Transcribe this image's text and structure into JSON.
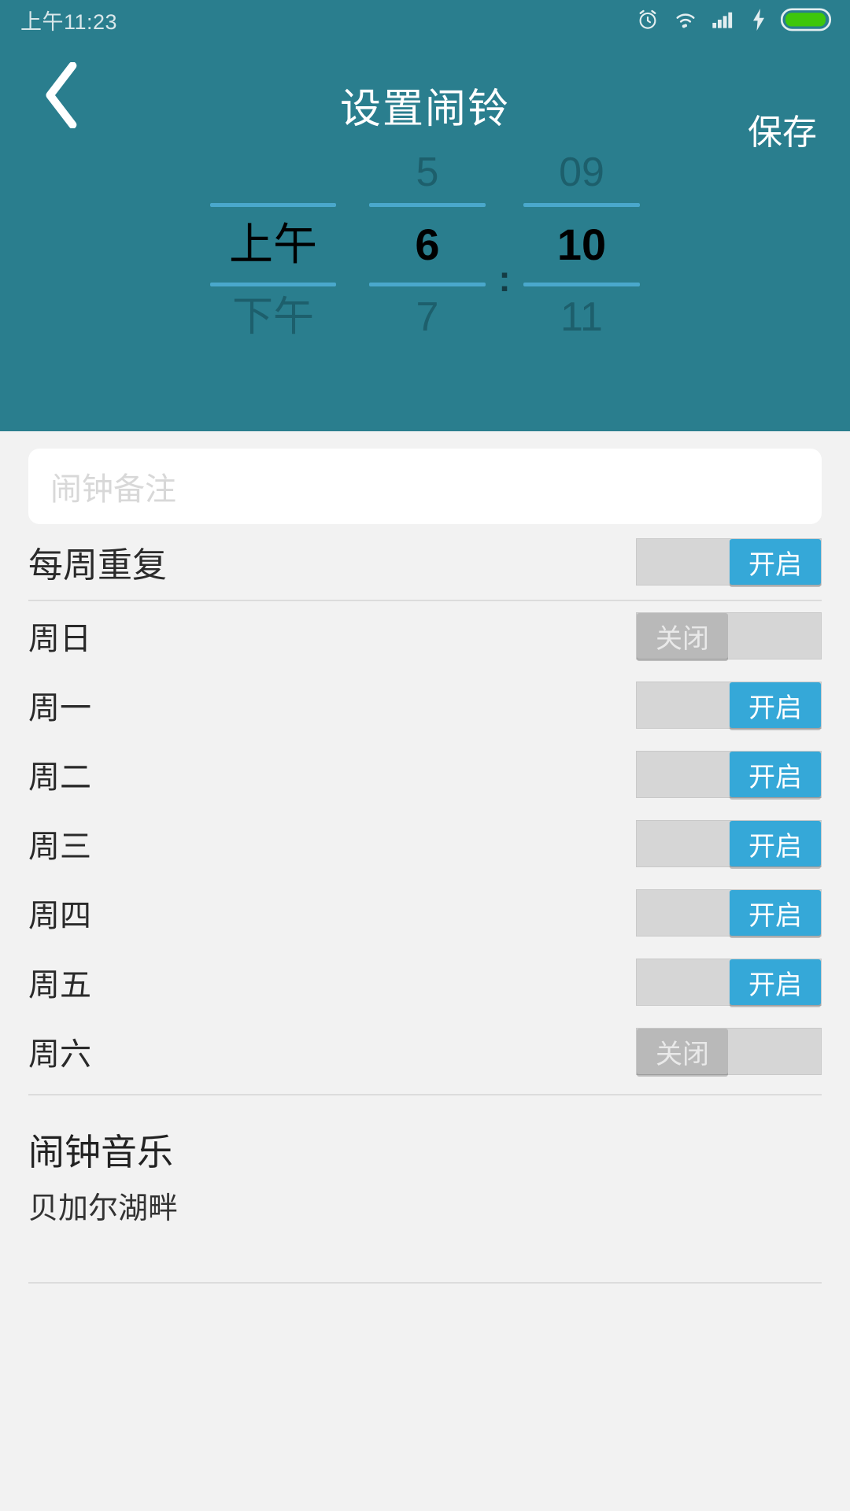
{
  "statusbar": {
    "time": "上午11:23",
    "icons": [
      "alarm-icon",
      "wifi-icon",
      "signal-icon",
      "charging-icon",
      "battery-icon"
    ]
  },
  "header": {
    "back_icon": "chevron-left-icon",
    "title": "设置闹铃",
    "save_label": "保存"
  },
  "time_picker": {
    "ampm": {
      "prev": "",
      "current": "上午",
      "next": "下午"
    },
    "hour": {
      "prev": "5",
      "current": "6",
      "next": "7"
    },
    "separator": ":",
    "minute": {
      "prev": "09",
      "current": "10",
      "next": "11"
    }
  },
  "note": {
    "placeholder": "闹钟备注",
    "value": ""
  },
  "repeat": {
    "label": "每周重复",
    "toggle": {
      "state": "on",
      "on_label": "开启",
      "off_label": "关闭"
    }
  },
  "days": [
    {
      "label": "周日",
      "state": "off",
      "text": "关闭"
    },
    {
      "label": "周一",
      "state": "on",
      "text": "开启"
    },
    {
      "label": "周二",
      "state": "on",
      "text": "开启"
    },
    {
      "label": "周三",
      "state": "on",
      "text": "开启"
    },
    {
      "label": "周四",
      "state": "on",
      "text": "开启"
    },
    {
      "label": "周五",
      "state": "on",
      "text": "开启"
    },
    {
      "label": "周六",
      "state": "off",
      "text": "关闭"
    }
  ],
  "music": {
    "title": "闹钟音乐",
    "value": "贝加尔湖畔"
  },
  "colors": {
    "header_bg": "#2a7e8e",
    "accent_blue": "#35a8d8",
    "rule_blue": "#4aa8cc",
    "page_bg": "#f2f2f2",
    "battery_green": "#3ec70b"
  }
}
